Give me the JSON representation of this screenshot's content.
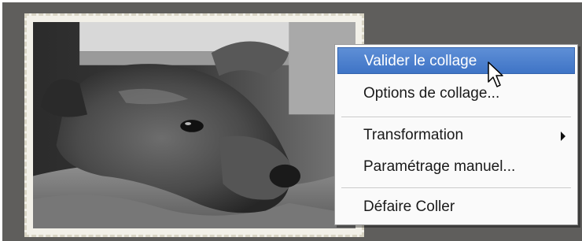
{
  "context_menu": {
    "items": [
      {
        "label": "Valider le collage",
        "highlighted": true
      },
      {
        "label": "Options de collage..."
      },
      {
        "label": "Transformation",
        "has_submenu": true
      },
      {
        "label": "Paramétrage manuel..."
      },
      {
        "label": "Défaire Coller"
      }
    ]
  },
  "colors": {
    "background": "#5f5e5c",
    "highlight": "#4a7fcb",
    "menu_bg": "#fafafa"
  },
  "icons": [
    "pointer-cursor-icon",
    "submenu-arrow-icon"
  ]
}
